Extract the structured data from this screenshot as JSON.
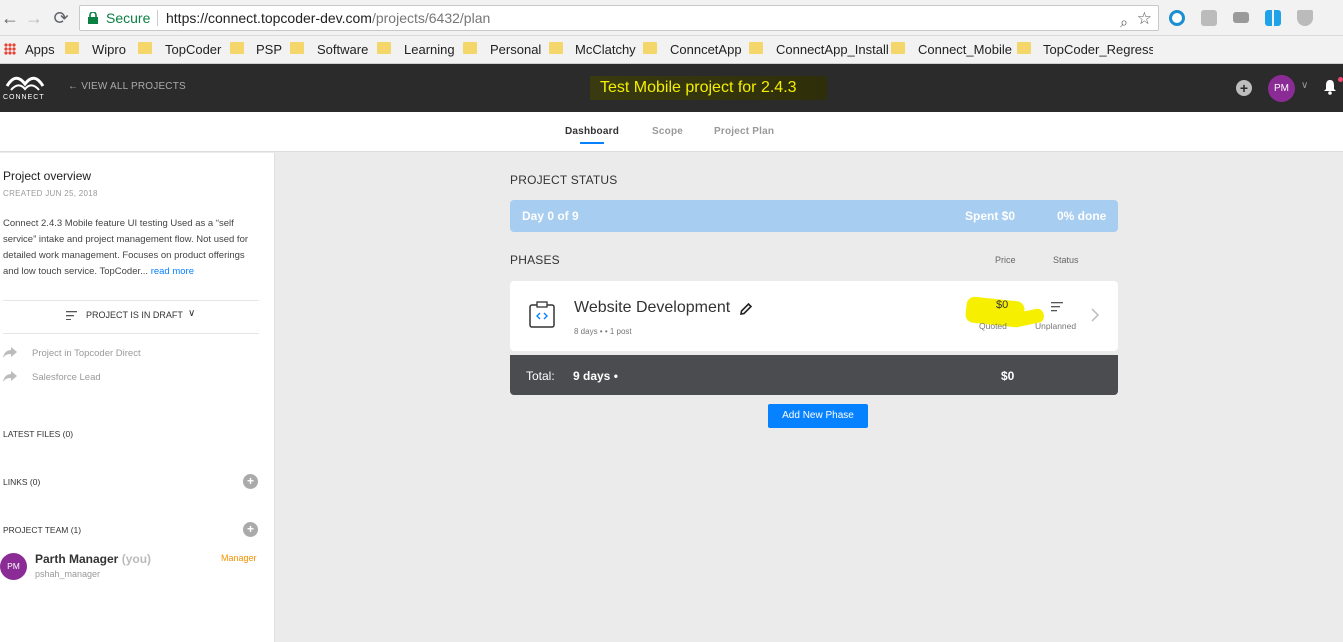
{
  "browser": {
    "secure_label": "Secure",
    "url_host": "https://connect.topcoder-dev.com",
    "url_path": "/projects/6432/plan",
    "bookmarks": [
      "Apps",
      "Wipro",
      "TopCoder",
      "PSP",
      "Software",
      "Learning",
      "Personal",
      "McClatchy",
      "ConncetApp",
      "ConnectApp_Install",
      "Connect_Mobile",
      "TopCoder_Regressio"
    ]
  },
  "header": {
    "logo_text": "CONNECT",
    "back_link": "VIEW ALL PROJECTS",
    "project_title": "Test Mobile project for 2.4.3",
    "user_initials": "PM"
  },
  "tabs": [
    "Dashboard",
    "Scope",
    "Project Plan"
  ],
  "sidebar": {
    "title": "Project overview",
    "created": "CREATED JUN 25, 2018",
    "description": "Connect 2.4.3 Mobile feature UI testing Used as a “self service” intake and project management flow. Not used for detailed work management. Focuses on product offerings and low touch service. TopCoder...",
    "read_more": "read more",
    "draft_status": "PROJECT IS IN DRAFT",
    "links": [
      "Project in Topcoder Direct",
      "Salesforce Lead"
    ],
    "latest_files": "LATEST FILES (0)",
    "links_label": "LINKS (0)",
    "team_label": "PROJECT TEAM (1)",
    "member": {
      "initials": "PM",
      "name": "Parth Manager",
      "you": "(you)",
      "handle": "pshah_manager",
      "role": "Manager"
    }
  },
  "main": {
    "project_status_label": "PROJECT STATUS",
    "status": {
      "day": "Day 0 of 9",
      "spent": "Spent $0",
      "done": "0% done",
      "progress_percent": 0
    },
    "phases_label": "PHASES",
    "col_price": "Price",
    "col_status": "Status",
    "phase": {
      "name": "Website Development",
      "meta": "8 days •   • 1 post",
      "price": "$0",
      "price_sub": "Quoted",
      "status_sub": "Unplanned"
    },
    "total": {
      "label": "Total:",
      "days": "9 days •",
      "price": "$0"
    },
    "add_phase": "Add New Phase"
  },
  "colors": {
    "accent": "#0681ff",
    "header_bg": "#2b2b2b",
    "avatar": "#8b2c96",
    "highlight": "#f7ef00"
  }
}
